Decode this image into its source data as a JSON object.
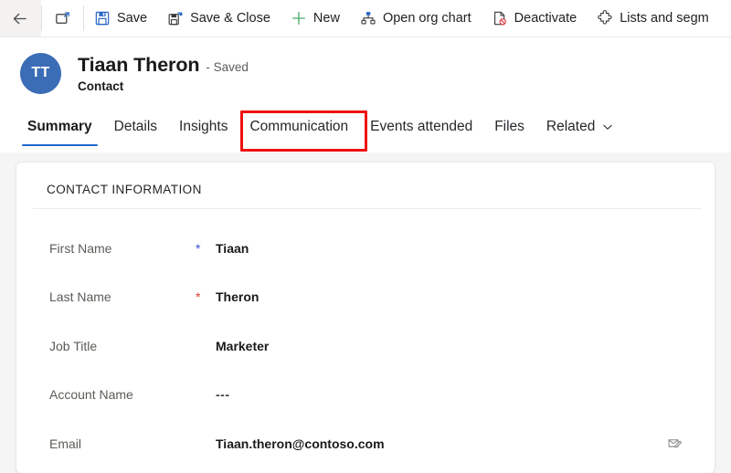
{
  "commandbar": {
    "items": [
      {
        "icon": "back-arrow-icon",
        "label": "",
        "name": "back-button"
      },
      {
        "icon": "popout-icon",
        "label": "",
        "name": "popout-button"
      },
      {
        "icon": "save-icon",
        "label": "Save",
        "name": "save-button"
      },
      {
        "icon": "save-close-icon",
        "label": "Save & Close",
        "name": "save-and-close-button"
      },
      {
        "icon": "plus-icon",
        "label": "New",
        "name": "new-button"
      },
      {
        "icon": "org-chart-icon",
        "label": "Open org chart",
        "name": "open-org-chart-button"
      },
      {
        "icon": "deactivate-icon",
        "label": "Deactivate",
        "name": "deactivate-button"
      },
      {
        "icon": "puzzle-icon",
        "label": "Lists and segm",
        "name": "lists-and-segments-button"
      }
    ]
  },
  "record_header": {
    "avatar_initials": "TT",
    "avatar_color": "#3b6db6",
    "name": "Tiaan Theron",
    "status": "- Saved",
    "entity": "Contact"
  },
  "tabs": {
    "items": [
      {
        "label": "Summary",
        "name": "tab-summary",
        "active": true
      },
      {
        "label": "Details",
        "name": "tab-details",
        "active": false
      },
      {
        "label": "Insights",
        "name": "tab-insights",
        "active": false
      },
      {
        "label": "Communication",
        "name": "tab-communication",
        "active": false,
        "highlighted": true
      },
      {
        "label": "Events attended",
        "name": "tab-events-attended",
        "active": false
      },
      {
        "label": "Files",
        "name": "tab-files",
        "active": false
      },
      {
        "label": "Related",
        "name": "tab-related",
        "active": false,
        "chevron": true
      }
    ],
    "active_underline_color": "#2266cc",
    "highlight_color": "#ee1111"
  },
  "card": {
    "title": "CONTACT INFORMATION",
    "fields": [
      {
        "label": "First Name",
        "required": "recommended",
        "value": "Tiaan",
        "name": "field-first-name"
      },
      {
        "label": "Last Name",
        "required": "required",
        "value": "Theron",
        "name": "field-last-name"
      },
      {
        "label": "Job Title",
        "required": "none",
        "value": "Marketer",
        "name": "field-job-title"
      },
      {
        "label": "Account Name",
        "required": "none",
        "value": "---",
        "name": "field-account-name"
      },
      {
        "label": "Email",
        "required": "none",
        "value": "Tiaan.theron@contoso.com",
        "name": "field-email",
        "action_icon": "compose-email-icon"
      }
    ]
  }
}
